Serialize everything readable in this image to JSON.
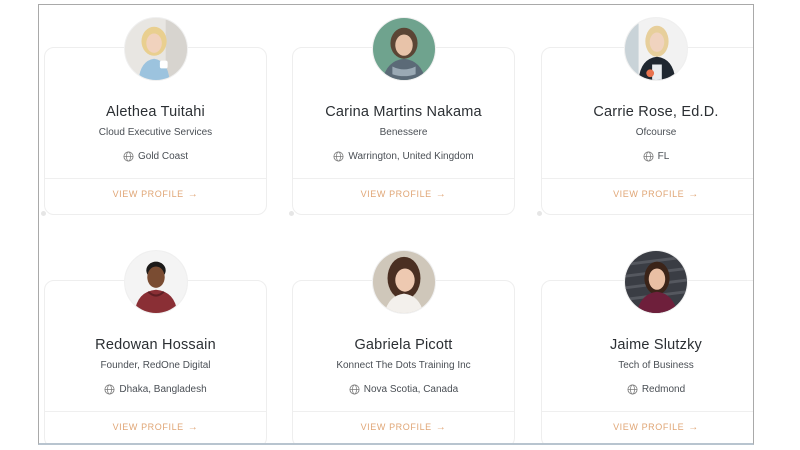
{
  "cards": [
    {
      "name": "Alethea Tuitahi",
      "company": "Cloud Executive Services",
      "location": "Gold Coast",
      "cta": "VIEW PROFILE",
      "arrow": "→"
    },
    {
      "name": "Carina Martins Nakama",
      "company": "Benessere",
      "location": "Warrington, United Kingdom",
      "cta": "VIEW PROFILE",
      "arrow": "→"
    },
    {
      "name": "Carrie Rose, Ed.D.",
      "company": "Ofcourse",
      "location": "FL",
      "cta": "VIEW PROFILE",
      "arrow": "→"
    },
    {
      "name": "Redowan Hossain",
      "company": "Founder, RedOne Digital",
      "location": "Dhaka, Bangladesh",
      "cta": "VIEW PROFILE",
      "arrow": "→"
    },
    {
      "name": "Gabriela Picott",
      "company": "Konnect The Dots Training Inc",
      "location": "Nova Scotia, Canada",
      "cta": "VIEW PROFILE",
      "arrow": "→"
    },
    {
      "name": "Jaime Slutzky",
      "company": "Tech of Business",
      "location": "Redmond",
      "cta": "VIEW PROFILE",
      "arrow": "→"
    }
  ],
  "colors": {
    "accent": "#e0a676",
    "name_text": "#2b2f33",
    "meta_text": "#4a4f55"
  },
  "icons": {
    "location": "globe-icon",
    "cta": "arrow-right-icon"
  }
}
